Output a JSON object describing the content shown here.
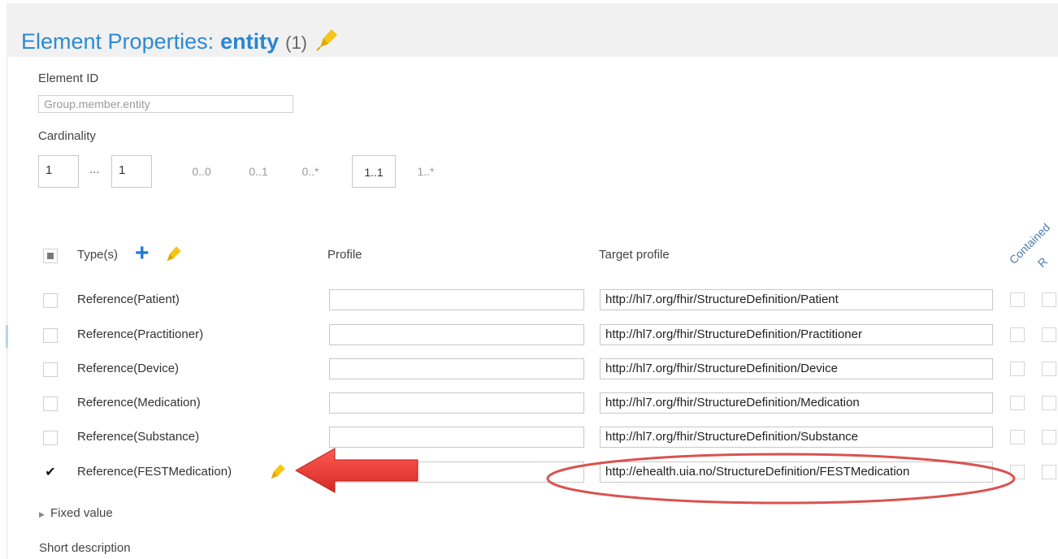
{
  "header": {
    "prefix": "Element Properties:",
    "element_name": "entity",
    "count": "(1)",
    "edit_icon": "pencil-icon"
  },
  "element_id": {
    "label": "Element ID",
    "placeholder": "Group.member.entity"
  },
  "cardinality": {
    "label": "Cardinality",
    "min": "1",
    "separator": "...",
    "max": "1",
    "presets": [
      "0..0",
      "0..1",
      "0..*",
      "1..1",
      "1..*"
    ],
    "selected": "1..1"
  },
  "types_table": {
    "columns": {
      "types": "Type(s)",
      "profile": "Profile",
      "target_profile": "Target profile",
      "contained": "Contained",
      "rules": "R"
    },
    "rows": [
      {
        "type": "Reference(Patient)",
        "checked": false,
        "profile": "",
        "target_profile": "http://hl7.org/fhir/StructureDefinition/Patient"
      },
      {
        "type": "Reference(Practitioner)",
        "checked": false,
        "profile": "",
        "target_profile": "http://hl7.org/fhir/StructureDefinition/Practitioner"
      },
      {
        "type": "Reference(Device)",
        "checked": false,
        "profile": "",
        "target_profile": "http://hl7.org/fhir/StructureDefinition/Device"
      },
      {
        "type": "Reference(Medication)",
        "checked": false,
        "profile": "",
        "target_profile": "http://hl7.org/fhir/StructureDefinition/Medication"
      },
      {
        "type": "Reference(Substance)",
        "checked": false,
        "profile": "",
        "target_profile": "http://hl7.org/fhir/StructureDefinition/Substance"
      },
      {
        "type": "Reference(FESTMedication)",
        "checked": true,
        "check_mark": "✔",
        "profile": "",
        "target_profile": "http://ehealth.uia.no/StructureDefinition/FESTMedication"
      }
    ]
  },
  "fixed_value": {
    "label": "Fixed value"
  },
  "short_description": {
    "label": "Short description"
  },
  "annotation": {
    "arrow_color": "#e53935",
    "ellipse_color": "#d9534f"
  },
  "colors": {
    "accent": "#2a86d0",
    "pencil": "#f5c518"
  }
}
